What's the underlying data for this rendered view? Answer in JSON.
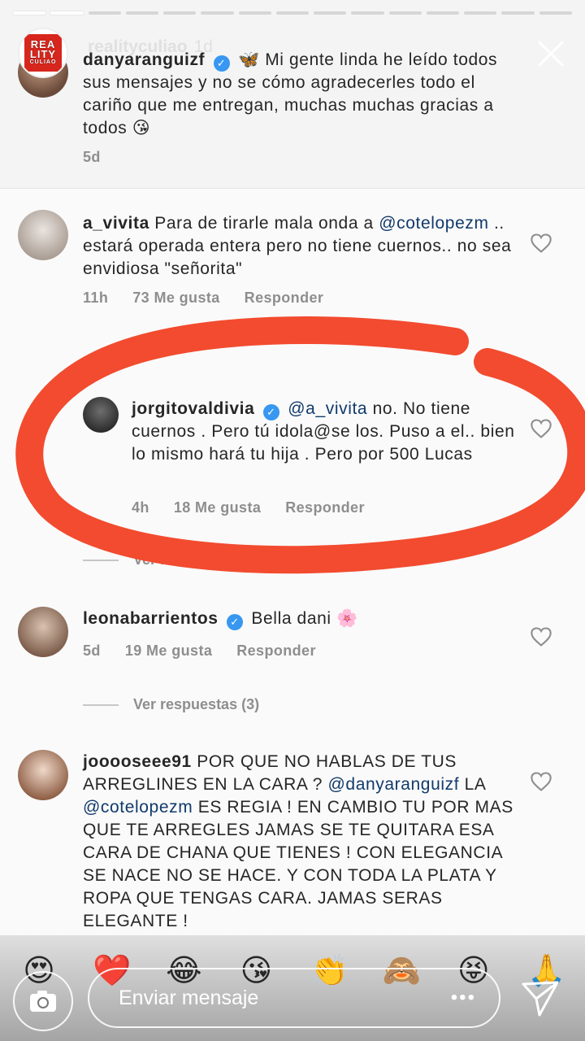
{
  "story": {
    "progress_segments": 15,
    "progress_done": 2,
    "username": "realityculiao",
    "time": "1d",
    "logo_text": [
      "REA",
      "LITY",
      "CULIAO"
    ]
  },
  "caption": {
    "username": "danyaranguizf",
    "emoji": "🦋",
    "text": "Mi gente linda he leído todos sus mensajes y no se cómo agradecerles todo el cariño que me entregan, muchas muchas gracias a todos 😘",
    "time": "5d"
  },
  "comments": [
    {
      "username": "a_vivita",
      "text_before": "Para de tirarle mala onda a ",
      "mention": "@cotelopezm",
      "text_after": " .. estará operada entera pero no tiene cuernos.. no sea envidiosa \"señorita\"",
      "time": "11h",
      "likes": "73 Me gusta",
      "reply": "Responder"
    },
    {
      "username": "jorgitovaldivia",
      "verified": true,
      "mention": "@a_vivita",
      "text_after": " no. No tiene cuernos . Pero tú idola@se los. Puso a el.. bien lo mismo hará tu hija . Pero  por 500 Lucas",
      "time": "4h",
      "likes": "18 Me gusta",
      "reply": "Responder",
      "view_more": "Ver más respuestas"
    },
    {
      "username": "leonabarrientos",
      "verified": true,
      "text": "Bella dani 🌸",
      "time": "5d",
      "likes": "19 Me gusta",
      "reply": "Responder",
      "view_replies": "Ver respuestas (3)"
    },
    {
      "username": "jooooseee91",
      "text_1": "POR QUE NO HABLAS DE TUS ARREGLINES EN LA CARA ? ",
      "mention_1": "@danyaranguizf",
      "text_2": " LA ",
      "mention_2": "@cotelopezm",
      "text_3": " ES REGIA ! EN CAMBIO TU POR MAS QUE TE ARREGLES JAMAS SE TE QUITARA ESA CARA DE CHANA QUE TIENES ! CON ELEGANCIA SE NACE NO SE HACE. Y CON TODA LA PLATA Y ROPA QUE TENGAS CARA. JAMAS SERAS ELEGANTE !"
    }
  ],
  "reactions": [
    "😍",
    "❤️",
    "😂",
    "😘",
    "👏",
    "🙈",
    "😝",
    "🙏"
  ],
  "composer": {
    "placeholder": "Enviar mensaje",
    "more": "•••"
  },
  "colors": {
    "annotation_red": "#f24b2f",
    "verified_blue": "#3897f0",
    "mention": "#113a6b"
  }
}
